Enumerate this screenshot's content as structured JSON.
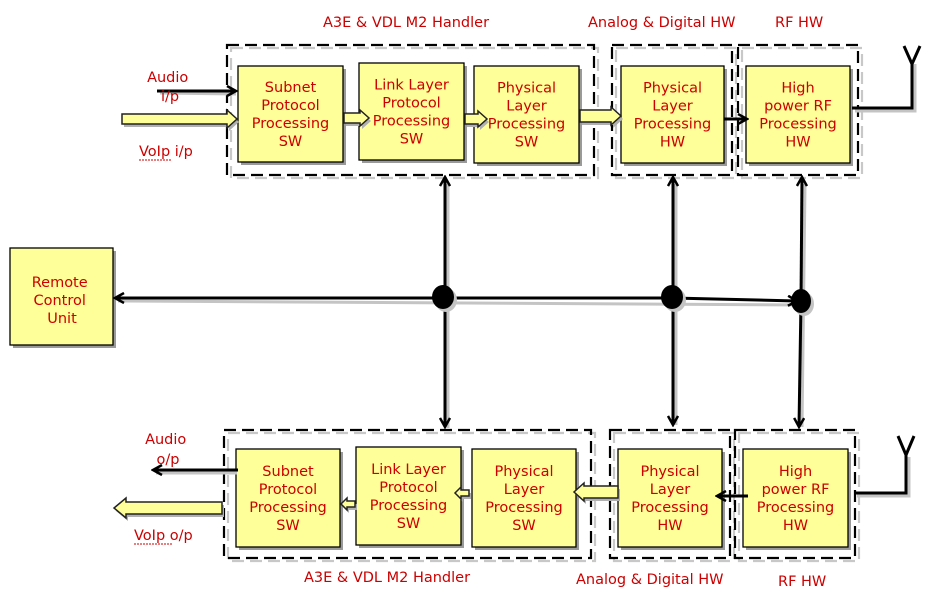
{
  "groups": {
    "top_sw": {
      "title": "A3E & VDL M2 Handler"
    },
    "top_ad": {
      "title": "Analog & Digital  HW"
    },
    "top_rf": {
      "title": "RF HW"
    },
    "bot_sw": {
      "title": "A3E & VDL M2 Handler"
    },
    "bot_ad": {
      "title": "Analog & Digital  HW"
    },
    "bot_rf": {
      "title": "RF HW"
    }
  },
  "top_blocks": [
    {
      "lines": [
        "Subnet",
        "Protocol",
        "Processing",
        "SW"
      ]
    },
    {
      "lines": [
        "Link Layer",
        "Protocol",
        "Processing",
        "SW"
      ]
    },
    {
      "lines": [
        "Physical",
        "Layer",
        "Processing",
        "SW"
      ]
    },
    {
      "lines": [
        "Physical",
        "Layer",
        "Processing",
        "HW"
      ]
    },
    {
      "lines": [
        "High",
        "power RF",
        "Processing",
        "HW"
      ]
    }
  ],
  "bottom_blocks": [
    {
      "lines": [
        "Subnet",
        "Protocol",
        "Processing",
        "SW"
      ]
    },
    {
      "lines": [
        "Link Layer",
        "Protocol",
        "Processing",
        "SW"
      ]
    },
    {
      "lines": [
        "Physical",
        "Layer",
        "Processing",
        "SW"
      ]
    },
    {
      "lines": [
        "Physical",
        "Layer",
        "Processing",
        "HW"
      ]
    },
    {
      "lines": [
        "High",
        "power RF",
        "Processing",
        "HW"
      ]
    }
  ],
  "remote_control": {
    "lines": [
      "Remote",
      "Control",
      "Unit"
    ]
  },
  "io_labels": {
    "audio_in": [
      "Audio",
      "i/p"
    ],
    "voip_in": "VoIp i/p",
    "audio_out": [
      "Audio",
      "o/p"
    ],
    "voip_out": "VoIp o/p"
  },
  "colors": {
    "text": "#cc0000",
    "block_fill": "#ffff99",
    "line": "#000000"
  }
}
